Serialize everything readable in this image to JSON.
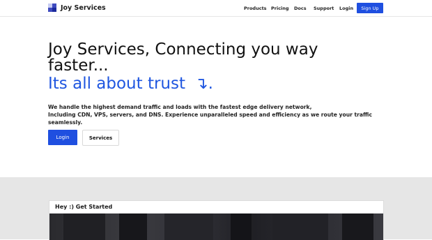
{
  "brand": {
    "name": "Joy Services",
    "logo_icon": "joy-logo-icon"
  },
  "nav": {
    "items": [
      "Products",
      "Pricing",
      "Docs",
      "Support",
      "Login"
    ],
    "signup_label": "Sign Up"
  },
  "hero": {
    "title": "Joy Services, Connecting you way faster...",
    "subtitle": "Its all about trust",
    "subtitle_arrow": "↴.",
    "description_line1": "We handle the highest demand traffic and loads with the fastest edge delivery network,",
    "description_line2": "Including CDN, VPS, servers, and DNS. Experience unparalleled speed and efficiency as we route your traffic seamlessly.",
    "login_label": "Login",
    "services_label": "Services"
  },
  "getting_started": {
    "title": "Hey :) Get Started"
  },
  "colors": {
    "accent": "#1f4fe0",
    "subtitle": "#1f56e0",
    "band": "#e6e6e6"
  }
}
